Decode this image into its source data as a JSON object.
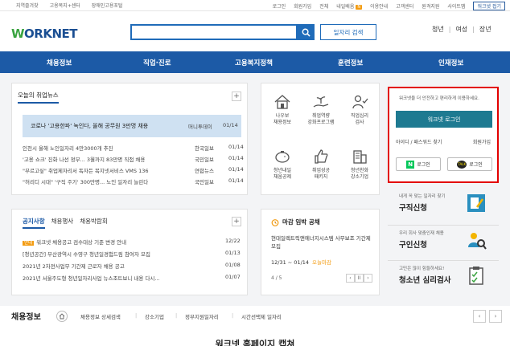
{
  "topbar": {
    "left_links": [
      "지역즐겨찾",
      "고용복지+센터",
      "장애인고용포털"
    ],
    "right_links": [
      "로그인",
      "회원가입",
      "전체",
      "내일배움",
      "이용안내",
      "고객센터",
      "원격지원",
      "사이트맵"
    ],
    "naeil_badge": "N",
    "mobile_label": "워크넷 접기"
  },
  "header": {
    "logo_text_w": "W",
    "logo_text_rest": "ORKNET",
    "search_placeholder": "",
    "job_search_label": "일자리 검색",
    "user_tabs": [
      "청년",
      "여성",
      "장년"
    ]
  },
  "gnb": [
    "채용정보",
    "직업·진로",
    "고용복지정책",
    "훈련정보",
    "인재정보"
  ],
  "news": {
    "tab_label": "오늘의 취업뉴스",
    "more": "+",
    "headline": {
      "title": "코로나 '고용한파' 녹인다, 올해 공무원 3만명 채용",
      "source": "머니투데이",
      "date": "01/14"
    },
    "items": [
      {
        "title": "인천시 올해 노인일자리 4만3000개 추진",
        "source": "한국일보",
        "date": "01/14"
      },
      {
        "title": "'고용 쇼크' 진화 나선 정부... 3월까지 83만명 직접 채용",
        "source": "국민일보",
        "date": "01/14"
      },
      {
        "title": "\"부르고싶\" 취업제자리서 독자든 복지넷서비스 VMS 136",
        "source": "연합뉴스",
        "date": "01/14"
      },
      {
        "title": "\"허리디 시대\" '구직 주기' 300만명... 노인 일자리 늘린다",
        "source": "국민일보",
        "date": "01/14"
      }
    ]
  },
  "quick": [
    {
      "label": "나우보\n채용정보",
      "icon": "house-icon"
    },
    {
      "label": "취업역량\n강화프로그램",
      "icon": "hand-plant-icon"
    },
    {
      "label": "직업심리\n검사",
      "icon": "person-check-icon"
    },
    {
      "label": "청년내일\n채움공제",
      "icon": "piggy-bank-icon"
    },
    {
      "label": "취업성공\n패키지",
      "icon": "thumbs-up-icon"
    },
    {
      "label": "청년친화\n강소기업",
      "icon": "building-icon"
    }
  ],
  "login": {
    "message": "워크넷을 더 안전하고 편리하게 이용하세요.",
    "button": "워크넷 로그인",
    "find": "아이디 / 패스워드 찾기",
    "join": "회원가입",
    "naver": "로그인",
    "naver_mark": "N",
    "kakao": "로그인",
    "kakao_mark": "TALK"
  },
  "services": [
    {
      "small": "내게 꼭 맞는 일자리 찾기",
      "big": "구직신청",
      "icon": "resume-pen-icon"
    },
    {
      "small": "우리 회사 맞춤인재 채용",
      "big": "구인신청",
      "icon": "person-search-icon"
    },
    {
      "small": "고민은 많이 힘들하세요!",
      "big": "청소년 심리검사",
      "icon": "clipboard-icon"
    }
  ],
  "notice": {
    "tabs": [
      "공지사항",
      "채용행사",
      "채용박람회"
    ],
    "more": "+",
    "items": [
      {
        "tag": "안내",
        "title": "워크넷 채용공고 검수대상 기준 변경 안내",
        "date": "12/22"
      },
      {
        "tag": "",
        "title": "[청년공간] 부산광역시 수영구 청년일경험드림 참여자 모집",
        "date": "01/13"
      },
      {
        "tag": "",
        "title": "2021년 2차전사업무 기간제 근로자 채용 공고",
        "date": "01/08"
      },
      {
        "tag": "",
        "title": "2021년 서울주도형 청년일자리사업 뉴스조트보니 내용 다시...",
        "date": "01/07"
      }
    ]
  },
  "deadline": {
    "title": "마감 임박 공채",
    "job": "현대일렉트릭앤에너지시스템 사무보조 기간제 모집",
    "date": "12/31 ~ 01/14",
    "tag": "오늘마감",
    "page": "4 / 5",
    "ctl": [
      "‹",
      "II",
      "›"
    ]
  },
  "jobbar": {
    "title": "채용정보",
    "links": [
      "채용정보 상세검색",
      "강소기업",
      "정부지원일자리",
      "시간선택제 일자리"
    ],
    "btns": [
      "‹",
      "›"
    ]
  },
  "caption": "워크넷 홈페이지 캡쳐"
}
